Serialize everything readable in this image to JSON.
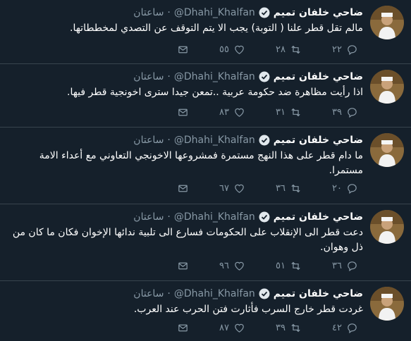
{
  "author": {
    "name": "ضاحي خلفان تميم",
    "handle": "@Dhahi_Khalfan",
    "time": "ساعتان"
  },
  "tweets": [
    {
      "text": "مالم تقل قطر علنا ( التوبة) يجب الا يتم التوقف عن التصدي لمخططاتها.",
      "replies": "٢٢",
      "retweets": "٢٨",
      "likes": "٥٥"
    },
    {
      "text": "اذا رأيت مظاهرة ضد حكومة عربية ..تمعن جيدا سترى اخونجية قطر فيها.",
      "replies": "٣٩",
      "retweets": "٣١",
      "likes": "٨٣"
    },
    {
      "text": "ما دام قطر على هذا النهج مستمرة فمشروعها الاخونجي التعاوني مع أعداء الامة مستمرا.",
      "replies": "٢٠",
      "retweets": "٣٦",
      "likes": "٦٧"
    },
    {
      "text": "دعت قطر الى الإنقلاب على الحكومات فسارع الى تلبية ندائها الإخوان فكان ما كان من ذل وهوان.",
      "replies": "٣٦",
      "retweets": "٥١",
      "likes": "٩٦"
    },
    {
      "text": "غردت قطر خارج السرب فأثارت فتن الحرب عند العرب.",
      "replies": "٤٢",
      "retweets": "٣٩",
      "likes": "٨٧"
    }
  ],
  "icons": {
    "reply": "reply-icon",
    "retweet": "retweet-icon",
    "like": "heart-icon",
    "message": "direct-message-icon",
    "verified": "verified-badge-icon"
  },
  "colors": {
    "background": "#15202b",
    "divider": "#38444d",
    "secondary_text": "#8899a6",
    "verified": "#1da1f2"
  }
}
